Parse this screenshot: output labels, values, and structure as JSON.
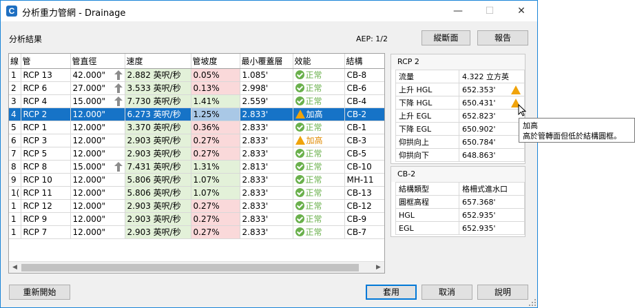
{
  "window": {
    "title": "分析重力管網 - Drainage",
    "icon": "civil3d-icon"
  },
  "titlebar_buttons": {
    "minimize": "—",
    "maximize": "☐",
    "close": "✕"
  },
  "results_label": "分析結果",
  "aep": "AEP: 1/2",
  "buttons": {
    "profile": "縱斷面",
    "report": "報告",
    "restart": "重新開始",
    "apply": "套用",
    "cancel": "取消",
    "help": "說明"
  },
  "grid": {
    "headers": [
      "線",
      "管",
      "管直徑",
      "速度",
      "管坡度",
      "最小覆蓋層",
      "效能",
      "結構"
    ],
    "rows": [
      {
        "line": "1",
        "pipe": "RCP 13",
        "dia": "42.000\"",
        "up": true,
        "vel": "2.882 英呎/秒",
        "vel_ok": true,
        "slope": "0.05%",
        "slope_ok": false,
        "cover": "1.085'",
        "eff": "正常",
        "eff_warn": false,
        "struct": "CB-8"
      },
      {
        "line": "2",
        "pipe": "RCP 6",
        "dia": "27.000\"",
        "up": true,
        "vel": "3.533 英呎/秒",
        "vel_ok": true,
        "slope": "0.13%",
        "slope_ok": false,
        "cover": "2.998'",
        "eff": "正常",
        "eff_warn": false,
        "struct": "CB-6"
      },
      {
        "line": "3",
        "pipe": "RCP 4",
        "dia": "15.000\"",
        "up": true,
        "vel": "7.730 英呎/秒",
        "vel_ok": true,
        "slope": "1.41%",
        "slope_ok": true,
        "cover": "2.559'",
        "eff": "正常",
        "eff_warn": false,
        "struct": "CB-4"
      },
      {
        "line": "4",
        "pipe": "RCP 2",
        "dia": "12.000\"",
        "up": false,
        "vel": "6.273 英呎/秒",
        "vel_ok": true,
        "slope": "1.25%",
        "slope_ok": true,
        "cover": "2.833'",
        "eff": "加高",
        "eff_warn": true,
        "struct": "CB-2",
        "selected": true
      },
      {
        "line": "5",
        "pipe": "RCP 1",
        "dia": "12.000\"",
        "up": false,
        "vel": "3.370 英呎/秒",
        "vel_ok": true,
        "slope": "0.36%",
        "slope_ok": false,
        "cover": "2.833'",
        "eff": "正常",
        "eff_warn": false,
        "struct": "CB-1"
      },
      {
        "line": "6",
        "pipe": "RCP 3",
        "dia": "12.000\"",
        "up": false,
        "vel": "2.903 英呎/秒",
        "vel_ok": true,
        "slope": "0.27%",
        "slope_ok": false,
        "cover": "2.833'",
        "eff": "加高",
        "eff_warn": true,
        "struct": "CB-3"
      },
      {
        "line": "7",
        "pipe": "RCP 5",
        "dia": "12.000\"",
        "up": false,
        "vel": "2.903 英呎/秒",
        "vel_ok": true,
        "slope": "0.27%",
        "slope_ok": false,
        "cover": "2.833'",
        "eff": "正常",
        "eff_warn": false,
        "struct": "CB-5"
      },
      {
        "line": "8",
        "pipe": "RCP 8",
        "dia": "15.000\"",
        "up": true,
        "vel": "7.431 英呎/秒",
        "vel_ok": true,
        "slope": "1.31%",
        "slope_ok": true,
        "cover": "2.813'",
        "eff": "正常",
        "eff_warn": false,
        "struct": "CB-10"
      },
      {
        "line": "9",
        "pipe": "RCP 10",
        "dia": "12.000\"",
        "up": false,
        "vel": "5.806 英呎/秒",
        "vel_ok": true,
        "slope": "1.07%",
        "slope_ok": true,
        "cover": "2.833'",
        "eff": "正常",
        "eff_warn": false,
        "struct": "MH-11"
      },
      {
        "line": "1(",
        "pipe": "RCP 11",
        "dia": "12.000\"",
        "up": false,
        "vel": "5.806 英呎/秒",
        "vel_ok": true,
        "slope": "1.07%",
        "slope_ok": true,
        "cover": "2.833'",
        "eff": "正常",
        "eff_warn": false,
        "struct": "CB-13"
      },
      {
        "line": "1",
        "pipe": "RCP 12",
        "dia": "12.000\"",
        "up": false,
        "vel": "2.903 英呎/秒",
        "vel_ok": true,
        "slope": "0.27%",
        "slope_ok": false,
        "cover": "2.833'",
        "eff": "正常",
        "eff_warn": false,
        "struct": "CB-12"
      },
      {
        "line": "1",
        "pipe": "RCP 9",
        "dia": "12.000\"",
        "up": false,
        "vel": "2.903 英呎/秒",
        "vel_ok": true,
        "slope": "0.27%",
        "slope_ok": false,
        "cover": "2.833'",
        "eff": "正常",
        "eff_warn": false,
        "struct": "CB-9"
      },
      {
        "line": "1",
        "pipe": "RCP 7",
        "dia": "12.000\"",
        "up": false,
        "vel": "2.903 英呎/秒",
        "vel_ok": true,
        "slope": "0.27%",
        "slope_ok": false,
        "cover": "2.833'",
        "eff": "正常",
        "eff_warn": false,
        "struct": "CB-7"
      }
    ]
  },
  "pipe_panel": {
    "title": "RCP 2",
    "rows": [
      {
        "name": "流量",
        "value": "4.322 立方英",
        "warn": false
      },
      {
        "name": "上升 HGL",
        "value": "652.353'",
        "warn": true
      },
      {
        "name": "下降 HGL",
        "value": "650.431'",
        "warn": true
      },
      {
        "name": "上升 EGL",
        "value": "652.823'",
        "warn": false
      },
      {
        "name": "下降 EGL",
        "value": "650.902'",
        "warn": false
      },
      {
        "name": "仰拱向上",
        "value": "650.784'",
        "warn": false
      },
      {
        "name": "仰拱向下",
        "value": "648.863'",
        "warn": false
      }
    ]
  },
  "structure_panel": {
    "title": "CB-2",
    "rows": [
      {
        "name": "結構類型",
        "value": "格柵式進水口"
      },
      {
        "name": "圓框高程",
        "value": "657.368'"
      },
      {
        "name": "HGL",
        "value": "652.935'"
      },
      {
        "name": "EGL",
        "value": "652.935'"
      }
    ]
  },
  "tooltip": {
    "title": "加高",
    "text": "高於管轉面但低於結構圓框。"
  },
  "colors": {
    "selected": "#1673c7",
    "ok_cell": "#e3f1d9",
    "bad_cell": "#fad9da",
    "ok_icon": "#6ab04c",
    "warn_icon": "#f0a30a"
  }
}
